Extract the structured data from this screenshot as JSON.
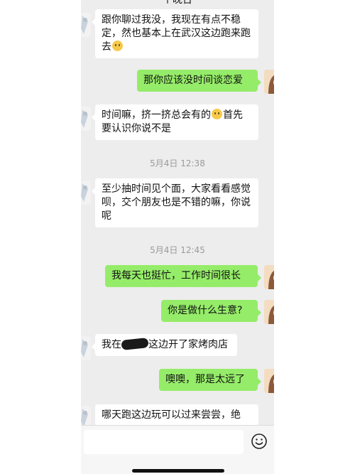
{
  "header": {
    "title": "个晚台"
  },
  "messages": [
    {
      "side": "in",
      "text_a": "跟你聊过我没，我现在有点不稳定，然也基本上在武汉这边跑来跑去",
      "emoji": "grinning-sweat-emoji"
    },
    {
      "side": "out",
      "text": "那你应该没时间谈恋爱"
    },
    {
      "side": "in",
      "text_a": "时间嘛，挤一挤总会有的",
      "emoji": "smile-emoji",
      "text_b": "首先要认识你说不是"
    },
    {
      "side": "in",
      "text": "至少抽时间见个面，大家看看感觉呗，交个朋友也是不错的嘛，你说呢"
    },
    {
      "side": "out",
      "text": "我每天也挺忙，工作时间很长"
    },
    {
      "side": "out",
      "text": "你是做什么生意?"
    },
    {
      "side": "in",
      "text_a": "我在",
      "redacted": true,
      "text_b": "这边开了家烤肉店"
    },
    {
      "side": "out",
      "text": "噢噢，那是太远了"
    },
    {
      "side": "in",
      "text": "哪天跑这边玩可以过来尝尝，绝"
    }
  ],
  "timestamps": [
    "5月4日 12:38",
    "5月4日 12:45"
  ],
  "input": {
    "placeholder": ""
  },
  "colors": {
    "out_bubble": "#95ec69",
    "in_bubble": "#ffffff",
    "background": "#ededed"
  },
  "icons": {
    "emoji_button": "emoji-smile-icon"
  }
}
